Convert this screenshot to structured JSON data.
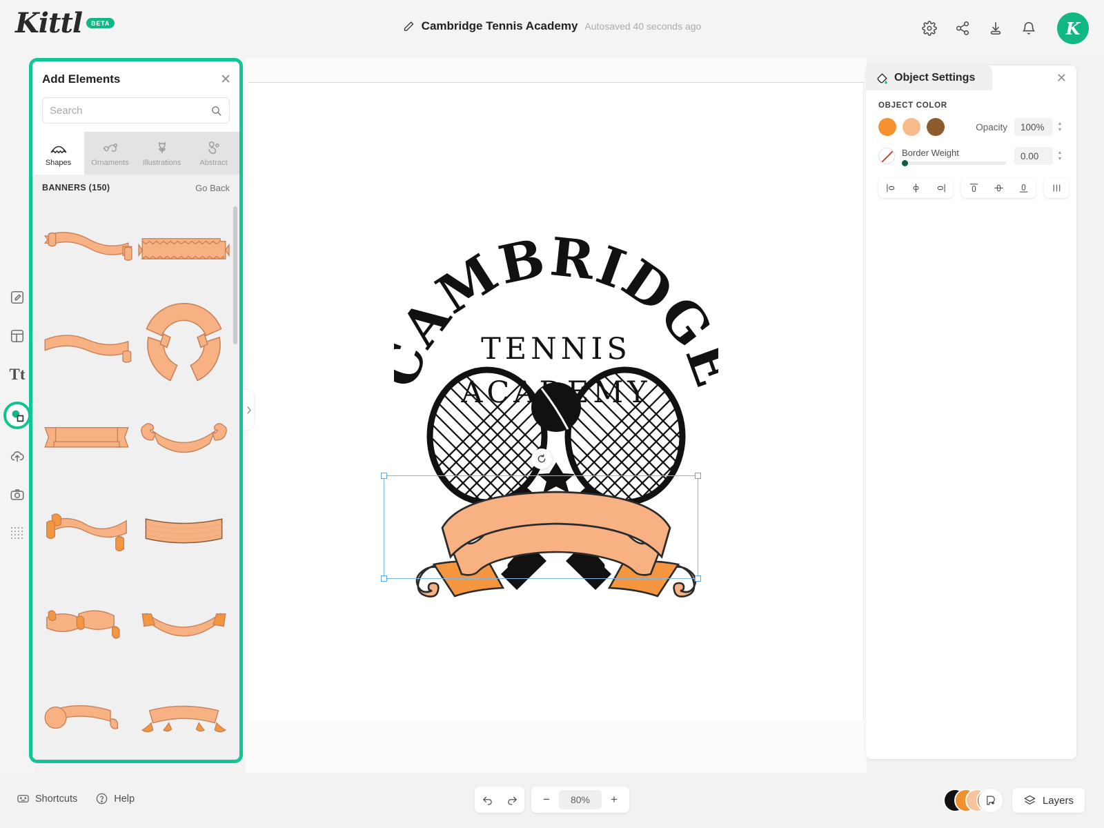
{
  "app": {
    "logo_text": "Kittl",
    "beta_label": "BETA"
  },
  "header": {
    "doc_title": "Cambridge Tennis Academy",
    "autosave_text": "Autosaved 40 seconds ago",
    "edit_icon": "pencil-icon",
    "icons": [
      "settings-gear-icon",
      "share-icon",
      "download-icon",
      "notifications-bell-icon"
    ],
    "avatar_letter": "K",
    "avatar_color": "#11b886"
  },
  "rail": {
    "items": [
      {
        "name": "design-edit",
        "icon": "pencil-square-icon",
        "active": false
      },
      {
        "name": "templates",
        "icon": "layout-template-icon",
        "active": false
      },
      {
        "name": "text",
        "icon": "text-tt-icon",
        "active": false
      },
      {
        "name": "elements",
        "icon": "elements-shapes-icon",
        "active": true
      },
      {
        "name": "uploads",
        "icon": "cloud-upload-icon",
        "active": false
      },
      {
        "name": "photos",
        "icon": "camera-icon",
        "active": false
      },
      {
        "name": "patterns",
        "icon": "dot-grid-icon",
        "active": false
      }
    ]
  },
  "panel": {
    "title": "Add Elements",
    "close_icon": "close-icon",
    "search": {
      "placeholder": "Search",
      "value": "",
      "icon": "search-icon"
    },
    "categories": [
      {
        "label": "Shapes",
        "icon": "shapes-banner-icon",
        "active": true
      },
      {
        "label": "Ornaments",
        "icon": "ornament-swirl-icon",
        "active": false
      },
      {
        "label": "Illustrations",
        "icon": "tulip-flower-icon",
        "active": false
      },
      {
        "label": "Abstract",
        "icon": "abstract-blobs-icon",
        "active": false
      }
    ],
    "section_label": "BANNERS (150)",
    "go_back_label": "Go Back",
    "collapse_icon": "chevron-right-icon",
    "thumbs": [
      {
        "name": "banner-wavy-ribbon"
      },
      {
        "name": "banner-zigzag-edge-straight"
      },
      {
        "name": "banner-simple-wave"
      },
      {
        "name": "banner-circular-ring"
      },
      {
        "name": "banner-flat-notched"
      },
      {
        "name": "banner-curved-scroll-ends"
      },
      {
        "name": "banner-double-fold-scroll"
      },
      {
        "name": "banner-curved-plain-strip"
      },
      {
        "name": "banner-stepped-ribbon"
      },
      {
        "name": "banner-arched-dip"
      },
      {
        "name": "banner-round-end-tail"
      },
      {
        "name": "banner-arched-footed"
      }
    ]
  },
  "object_settings": {
    "title": "Object Settings",
    "icon": "paint-bucket-icon",
    "close_icon": "close-icon",
    "color_section_label": "OBJECT COLOR",
    "swatches": [
      "#f5922f",
      "#f8bb8b",
      "#8c5a2b"
    ],
    "opacity_label": "Opacity",
    "opacity_value": "100%",
    "no_border_icon": "no-border-icon",
    "border_label": "Border Weight",
    "border_value": "0.00",
    "border_slider_percent": 0,
    "align_buttons": [
      {
        "name": "align-left-icon"
      },
      {
        "name": "align-center-horizontal-icon"
      },
      {
        "name": "align-right-icon"
      },
      {
        "name": "align-top-icon"
      },
      {
        "name": "align-middle-vertical-icon"
      },
      {
        "name": "align-bottom-icon"
      },
      {
        "name": "distribute-horizontal-icon"
      }
    ]
  },
  "canvas": {
    "logo": {
      "arc_text": "CAMBRIDGE",
      "line1": "TENNIS",
      "line2": "ACADEMY",
      "graphic": "crossed-tennis-rackets-with-ball-and-banner",
      "banner_color": "#f7b183",
      "banner_accent": "#f4963f"
    },
    "selection": {
      "rotate_icon": "rotate-handle-icon",
      "handle_color": "#5aa3e8"
    }
  },
  "bottom": {
    "shortcuts_label": "Shortcuts",
    "shortcuts_icon": "keyboard-icon",
    "help_label": "Help",
    "help_icon": "question-circle-icon",
    "undo_icon": "undo-arrow-icon",
    "redo_icon": "redo-arrow-icon",
    "zoom_out_label": "−",
    "zoom_value": "80%",
    "zoom_in_label": "+",
    "palette_colors": [
      "#111111",
      "#f0902f",
      "#f8c39b",
      "#9a5f2b"
    ],
    "palette_icon": "color-palette-icon",
    "layers_label": "Layers",
    "layers_icon": "layers-stack-icon"
  }
}
